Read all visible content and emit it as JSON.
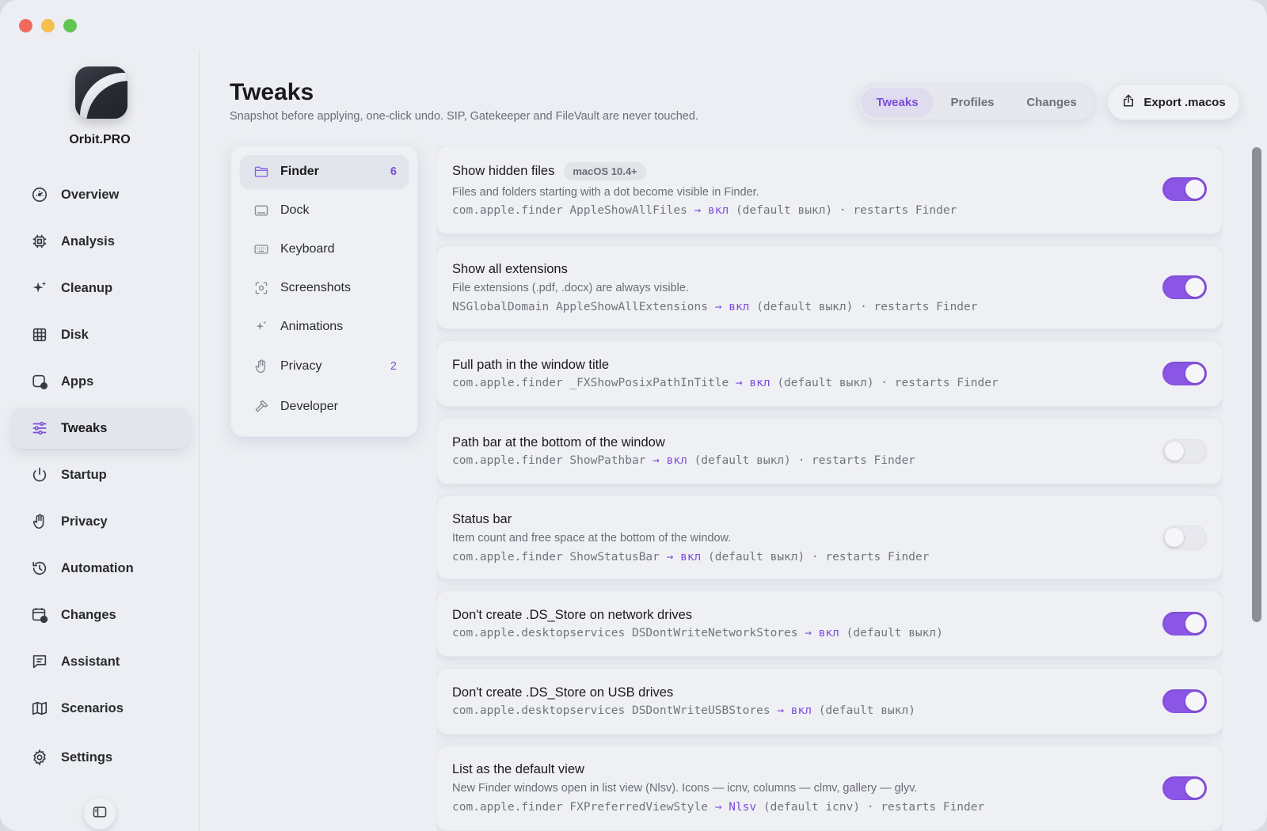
{
  "app": {
    "name": "Orbit.PRO"
  },
  "sidebar": {
    "items": [
      {
        "label": "Overview",
        "icon": "gauge-icon"
      },
      {
        "label": "Analysis",
        "icon": "cpu-icon"
      },
      {
        "label": "Cleanup",
        "icon": "sparkle-icon"
      },
      {
        "label": "Disk",
        "icon": "grid-icon"
      },
      {
        "label": "Apps",
        "icon": "app-check-icon"
      },
      {
        "label": "Tweaks",
        "icon": "sliders-icon",
        "active": true
      },
      {
        "label": "Startup",
        "icon": "power-icon"
      },
      {
        "label": "Privacy",
        "icon": "hand-icon"
      },
      {
        "label": "Automation",
        "icon": "history-icon"
      },
      {
        "label": "Changes",
        "icon": "calendar-clock-icon"
      },
      {
        "label": "Assistant",
        "icon": "chat-icon"
      },
      {
        "label": "Scenarios",
        "icon": "map-icon"
      },
      {
        "label": "Settings",
        "icon": "gear-icon"
      }
    ]
  },
  "header": {
    "title": "Tweaks",
    "subtitle": "Snapshot before applying, one-click undo. SIP, Gatekeeper and FileVault are never touched.",
    "tabs": [
      {
        "label": "Tweaks",
        "active": true
      },
      {
        "label": "Profiles"
      },
      {
        "label": "Changes"
      }
    ],
    "export_label": "Export .macos"
  },
  "categories": [
    {
      "label": "Finder",
      "count": "6",
      "icon": "folder-icon",
      "active": true
    },
    {
      "label": "Dock",
      "count": "",
      "icon": "dock-icon"
    },
    {
      "label": "Keyboard",
      "count": "",
      "icon": "keyboard-icon"
    },
    {
      "label": "Screenshots",
      "count": "",
      "icon": "screenshot-icon"
    },
    {
      "label": "Animations",
      "count": "",
      "icon": "sparkle-icon"
    },
    {
      "label": "Privacy",
      "count": "2",
      "icon": "hand-icon"
    },
    {
      "label": "Developer",
      "count": "",
      "icon": "hammer-icon"
    }
  ],
  "tweaks": [
    {
      "title": "Show hidden files",
      "badge": "macOS 10.4+",
      "description": "Files and folders starting with a dot become visible in Finder.",
      "code_key": "com.apple.finder AppleShowAllFiles",
      "code_value": "→ вкл",
      "code_tail": "(default выкл) · restarts Finder",
      "enabled": true
    },
    {
      "title": "Show all extensions",
      "badge": "",
      "description": "File extensions (.pdf, .docx) are always visible.",
      "code_key": "NSGlobalDomain AppleShowAllExtensions",
      "code_value": "→ вкл",
      "code_tail": "(default выкл) · restarts Finder",
      "enabled": true
    },
    {
      "title": "Full path in the window title",
      "badge": "",
      "description": "",
      "code_key": "com.apple.finder _FXShowPosixPathInTitle",
      "code_value": "→ вкл",
      "code_tail": "(default выкл) · restarts Finder",
      "enabled": true
    },
    {
      "title": "Path bar at the bottom of the window",
      "badge": "",
      "description": "",
      "code_key": "com.apple.finder ShowPathbar",
      "code_value": "→ вкл",
      "code_tail": "(default выкл) · restarts Finder",
      "enabled": false
    },
    {
      "title": "Status bar",
      "badge": "",
      "description": "Item count and free space at the bottom of the window.",
      "code_key": "com.apple.finder ShowStatusBar",
      "code_value": "→ вкл",
      "code_tail": "(default выкл) · restarts Finder",
      "enabled": false
    },
    {
      "title": "Don't create .DS_Store on network drives",
      "badge": "",
      "description": "",
      "code_key": "com.apple.desktopservices DSDontWriteNetworkStores",
      "code_value": "→ вкл",
      "code_tail": "(default выкл)",
      "enabled": true
    },
    {
      "title": "Don't create .DS_Store on USB drives",
      "badge": "",
      "description": "",
      "code_key": "com.apple.desktopservices DSDontWriteUSBStores",
      "code_value": "→ вкл",
      "code_tail": "(default выкл)",
      "enabled": true
    },
    {
      "title": "List as the default view",
      "badge": "",
      "description": "New Finder windows open in list view (Nlsv). Icons — icnv, columns — clmv, gallery — glyv.",
      "code_key": "com.apple.finder FXPreferredViewStyle",
      "code_value": "→ Nlsv",
      "code_tail": "(default icnv) · restarts Finder",
      "enabled": true
    }
  ]
}
